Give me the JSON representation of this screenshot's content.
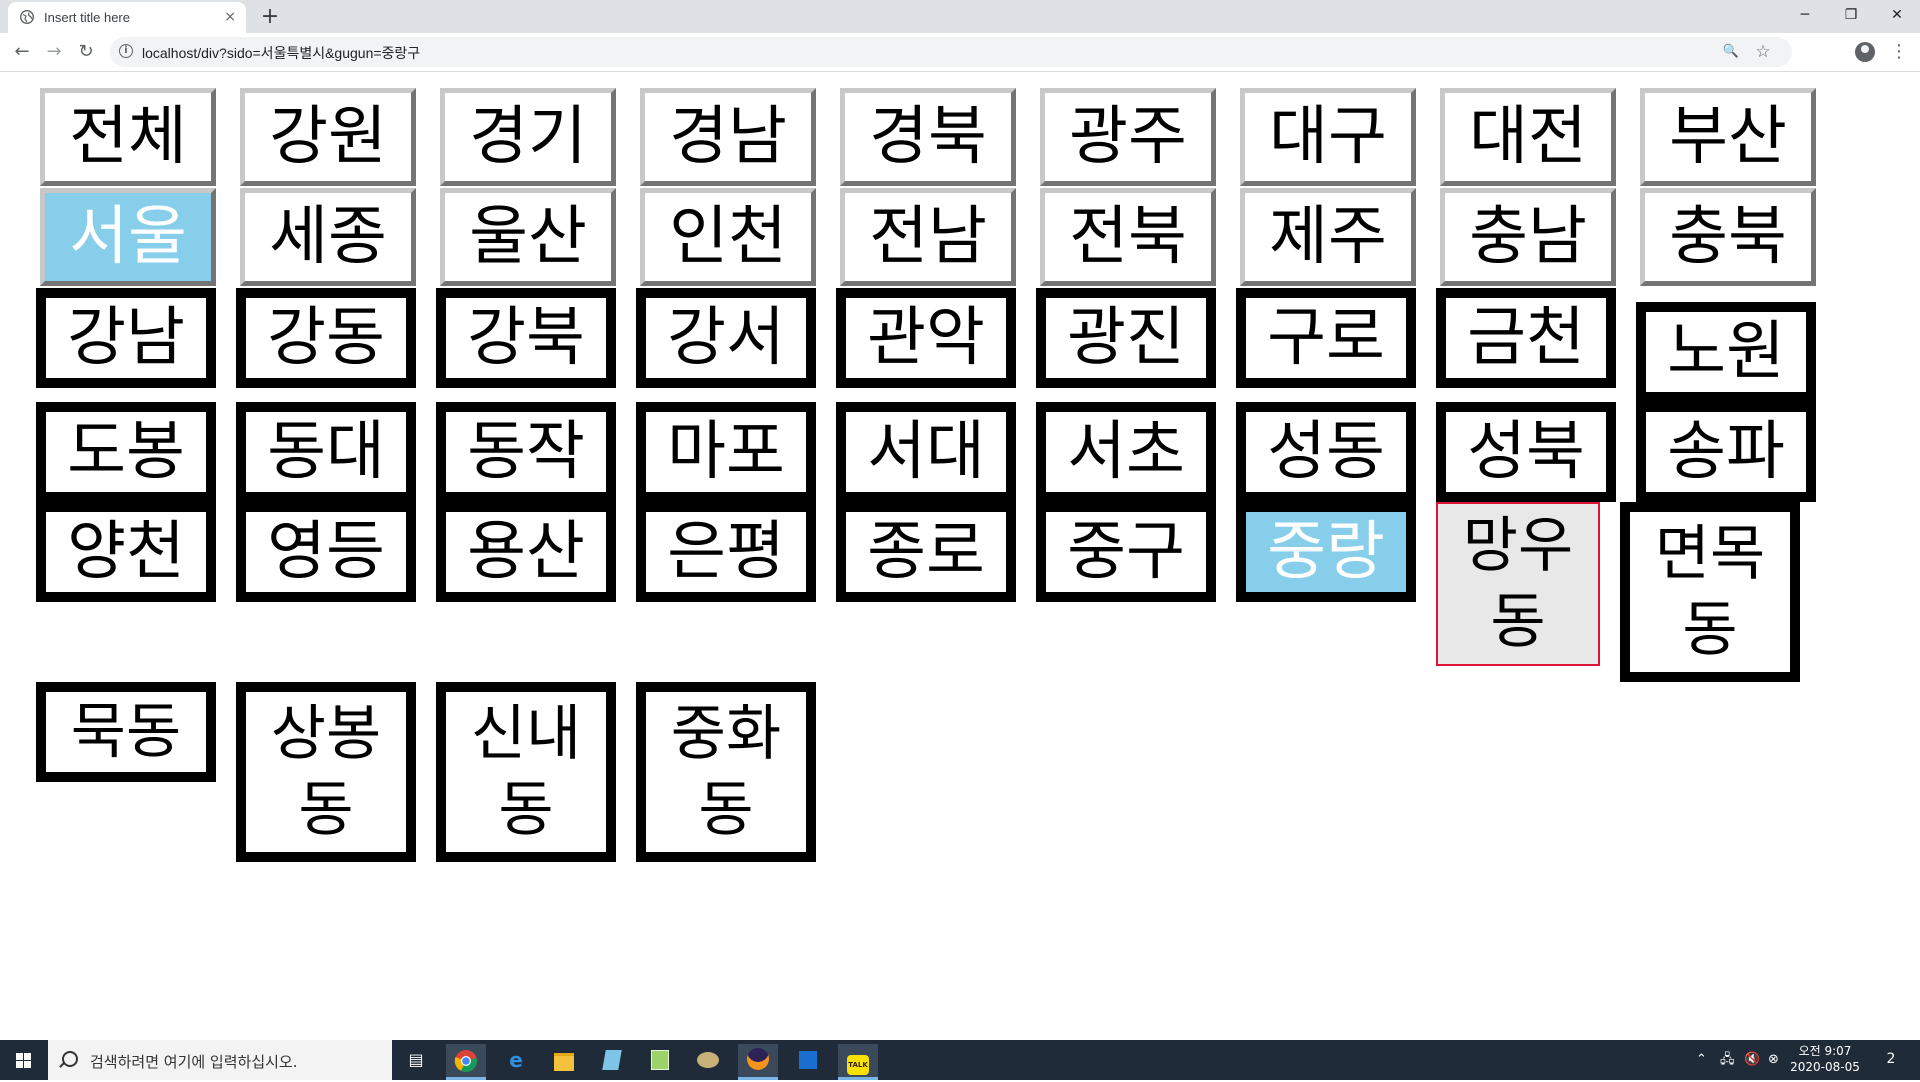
{
  "browser": {
    "tab_title": "Insert title here",
    "tab_close": "×",
    "new_tab": "+",
    "url": "localhost/div?sido=서울특별시&gugun=중랑구",
    "window_controls": {
      "minimize": "─",
      "restore": "❐",
      "close": "✕"
    },
    "nav": {
      "back": "←",
      "forward": "→",
      "reload": "↻"
    },
    "omnibox_icons": {
      "zoom": "🔍",
      "star": "☆"
    },
    "menu": "⋮",
    "info": "i"
  },
  "sido": {
    "row1": [
      "전체",
      "강원",
      "경기",
      "경남",
      "경북",
      "광주",
      "대구",
      "대전",
      "부산"
    ],
    "row2": [
      "서울",
      "세종",
      "울산",
      "인천",
      "전남",
      "전북",
      "제주",
      "충남",
      "충북"
    ],
    "selected": "서울"
  },
  "gugun": {
    "items": [
      "강남",
      "강동",
      "강북",
      "강서",
      "관악",
      "광진",
      "구로",
      "금천",
      "노원",
      "도봉",
      "동대",
      "동작",
      "마포",
      "서대",
      "서초",
      "성동",
      "성북",
      "송파",
      "양천",
      "영등",
      "용산",
      "은평",
      "종로",
      "중구",
      "중랑"
    ],
    "selected": "중랑"
  },
  "dong": {
    "items": [
      "망우\n동",
      "면목\n동",
      "묵동",
      "상봉\n동",
      "신내\n동",
      "중화\n동"
    ],
    "hovered": "망우동"
  },
  "taskbar": {
    "search_placeholder": "검색하려면 여기에 입력하십시오.",
    "clock_time": "오전 9:07",
    "clock_date": "2020-08-05",
    "notifications": "2",
    "icons": [
      "task-view-icon",
      "chrome-icon",
      "edge-icon",
      "file-explorer-icon",
      "notepad-icon",
      "notepad-plus-icon",
      "paint-icon",
      "eclipse-icon",
      "store-icon",
      "kakaotalk-icon"
    ]
  },
  "colors": {
    "selected_bg": "#87ceeb",
    "hover_border": "#dc143c",
    "hover_bg": "#e8e8e8"
  }
}
